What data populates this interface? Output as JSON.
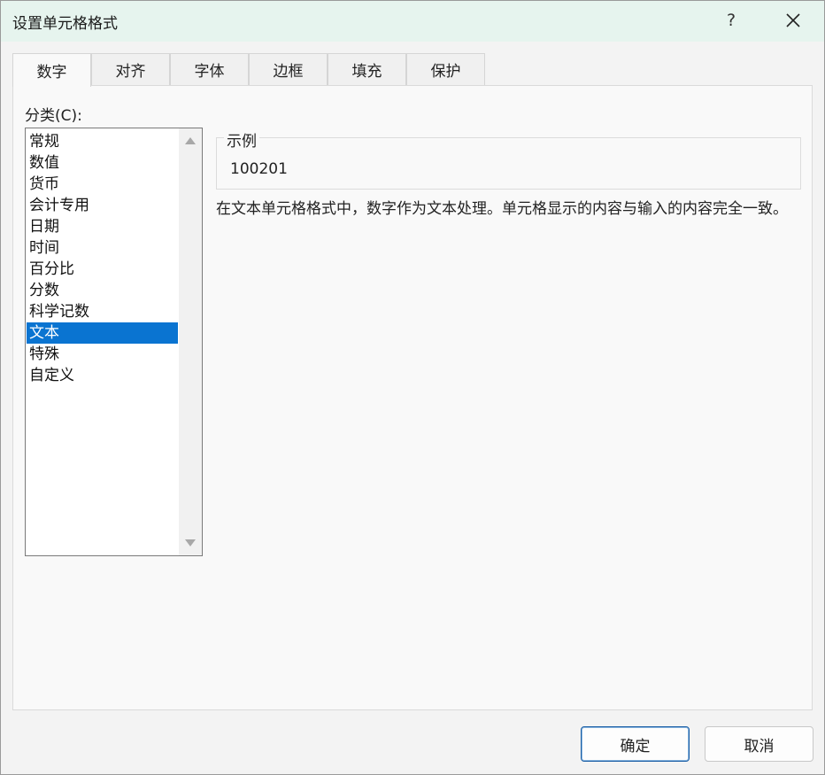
{
  "window": {
    "title": "设置单元格格式",
    "help_label": "?"
  },
  "tabs": [
    {
      "label": "数字",
      "active": true
    },
    {
      "label": "对齐"
    },
    {
      "label": "字体"
    },
    {
      "label": "边框"
    },
    {
      "label": "填充"
    },
    {
      "label": "保护"
    }
  ],
  "category": {
    "label": "分类(C):",
    "items": [
      "常规",
      "数值",
      "货币",
      "会计专用",
      "日期",
      "时间",
      "百分比",
      "分数",
      "科学记数",
      "文本",
      "特殊",
      "自定义"
    ],
    "selected": "文本"
  },
  "sample": {
    "legend": "示例",
    "value": "100201"
  },
  "description": "在文本单元格格式中，数字作为文本处理。单元格显示的内容与输入的内容完全一致。",
  "buttons": {
    "ok": "确定",
    "cancel": "取消"
  },
  "colors": {
    "selection": "#0a74d1",
    "titlebar": "#e6f4ee"
  }
}
